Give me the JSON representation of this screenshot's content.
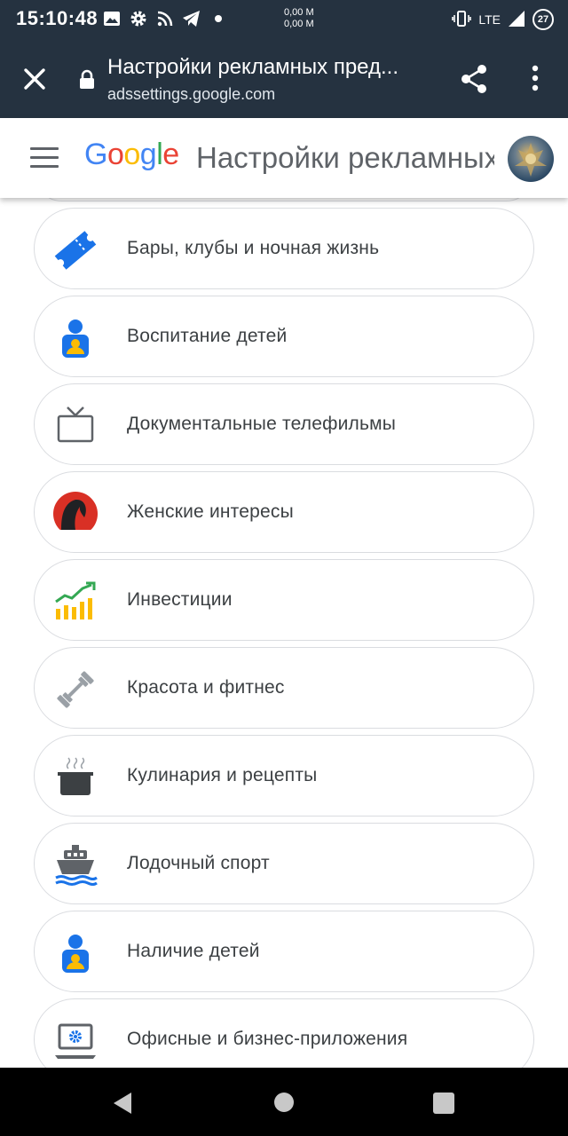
{
  "status_bar": {
    "time": "15:10:48",
    "net_up": "0,00 M",
    "net_down": "0,00 M",
    "network": "LTE",
    "battery": "27"
  },
  "browser": {
    "title": "Настройки рекламных пред...",
    "url": "adssettings.google.com"
  },
  "header": {
    "logo": "Google",
    "title": "Настройки рекламных предпочтений"
  },
  "topics": [
    {
      "label": "Бары, клубы и ночная жизнь",
      "icon": "ticket-icon"
    },
    {
      "label": "Воспитание детей",
      "icon": "person-icon"
    },
    {
      "label": "Документальные телефильмы",
      "icon": "tv-icon"
    },
    {
      "label": "Женские интересы",
      "icon": "woman-silhouette-icon"
    },
    {
      "label": "Инвестиции",
      "icon": "chart-growth-icon"
    },
    {
      "label": "Красота и фитнес",
      "icon": "dumbbell-icon"
    },
    {
      "label": "Кулинария и рецепты",
      "icon": "cooking-pot-icon"
    },
    {
      "label": "Лодочный спорт",
      "icon": "boat-icon"
    },
    {
      "label": "Наличие детей",
      "icon": "person-icon"
    },
    {
      "label": "Офисные и бизнес-приложения",
      "icon": "laptop-settings-icon"
    }
  ]
}
